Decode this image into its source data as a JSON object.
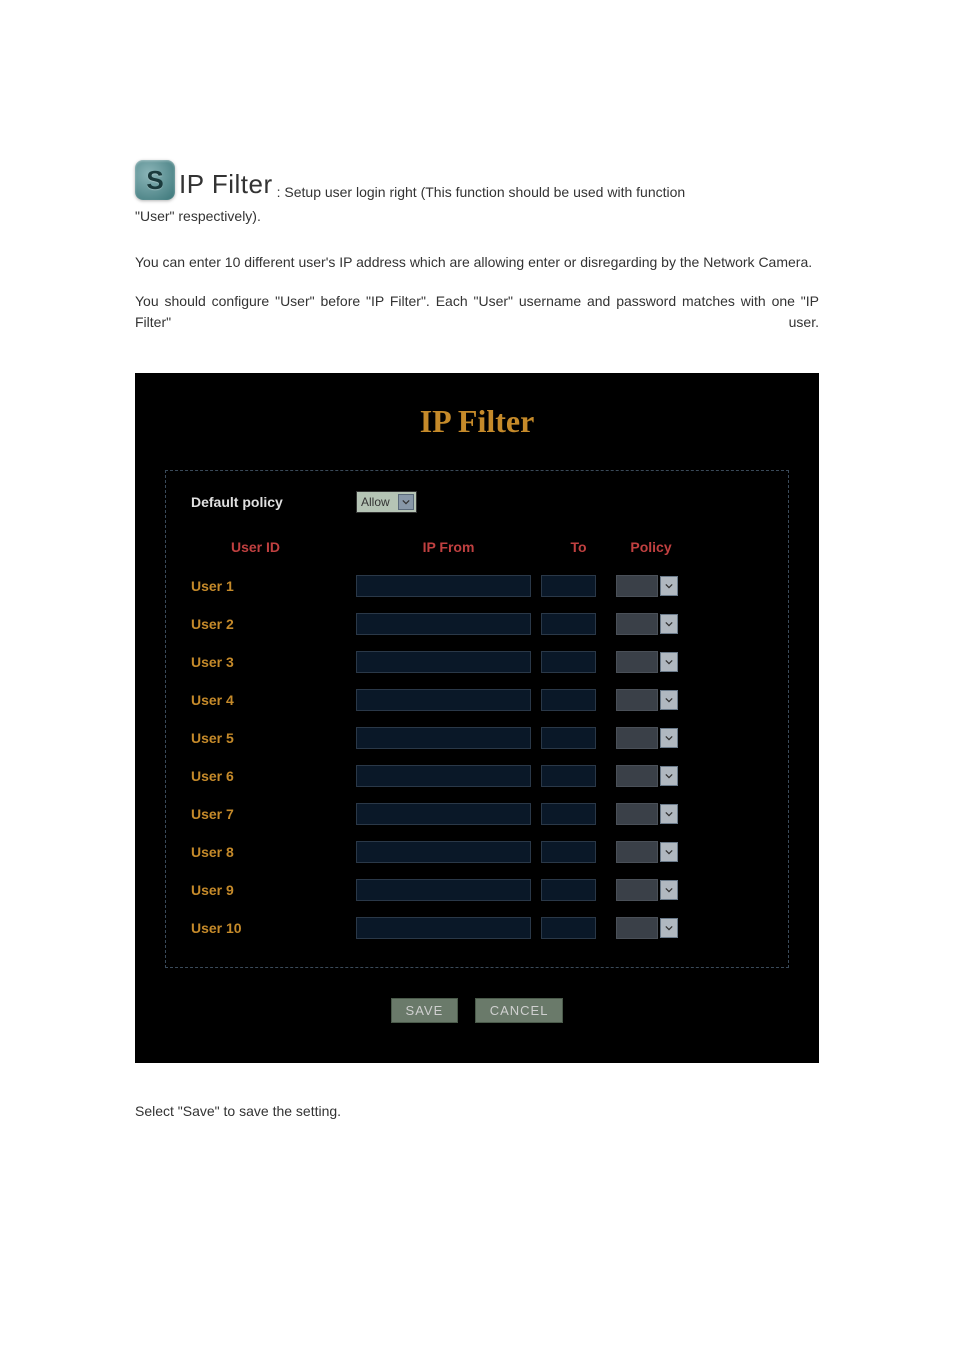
{
  "intro": {
    "icon_letter": "S",
    "title": "IP Filter",
    "title_desc": ": Setup user login right (This function should be used with function",
    "subtitle": "\"User\" respectively).",
    "para1": "You can enter 10 different user's IP address which are allowing enter or disregarding by the Network Camera.",
    "para2": "You should configure \"User\" before \"IP Filter\". Each \"User\" username and password matches with one \"IP Filter\" user."
  },
  "panel": {
    "title": "IP Filter",
    "default_policy_label": "Default policy",
    "default_policy_value": "Allow",
    "headers": {
      "user_id": "User ID",
      "ip_from": "IP From",
      "to": "To",
      "policy": "Policy"
    },
    "users": [
      {
        "label": "User 1"
      },
      {
        "label": "User 2"
      },
      {
        "label": "User 3"
      },
      {
        "label": "User 4"
      },
      {
        "label": "User 5"
      },
      {
        "label": "User 6"
      },
      {
        "label": "User 7"
      },
      {
        "label": "User 8"
      },
      {
        "label": "User 9"
      },
      {
        "label": "User 10"
      }
    ],
    "buttons": {
      "save": "SAVE",
      "cancel": "CANCEL"
    }
  },
  "closing": "Select \"Save\" to save the setting."
}
